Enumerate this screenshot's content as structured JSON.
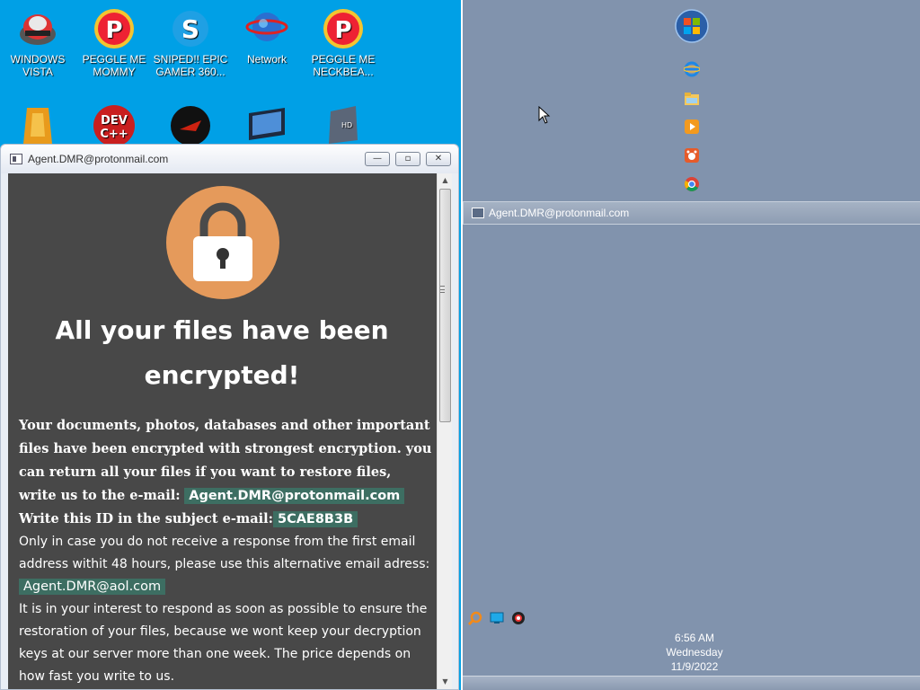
{
  "desktop": {
    "icons": [
      {
        "label": "WINDOWS VISTA"
      },
      {
        "label": "PEGGLE ME MOMMY"
      },
      {
        "label": "SNIPED!! EPIC GAMER 360..."
      },
      {
        "label": "Network"
      },
      {
        "label": "PEGGLE ME NECKBEA..."
      },
      {
        "label": "DEV C++",
        "glyph": "DEV C++"
      }
    ]
  },
  "window": {
    "title": "Agent.DMR@protonmail.com",
    "minimize": "—",
    "maximize": "▫",
    "close": "✕",
    "headline": "All your files have been encrypted!",
    "para1": "Your documents, photos, databases and other important files have been encrypted with strongest encryption. you can return all your files if you want to restore files, write us to the e-mail:",
    "email_primary": "Agent.DMR@protonmail.com",
    "id_prefix": "Write this ID in the subject e-mail:",
    "id_value": "5CAE8B3B",
    "para2": "Only in case you do not receive a response from the first email address withit 48 hours, please use this alternative email adress:",
    "email_alt": "Agent.DMR@aol.com",
    "para3": "It is in your interest to respond as soon as possible to ensure the restoration of your files, because we wont keep your decryption keys at our server more than one week. The price depends on how fast you write to us."
  },
  "taskbar": {
    "window_button": "Agent.DMR@protonmail.com",
    "clock_time": "6:56 AM",
    "clock_day": "Wednesday",
    "clock_date": "11/9/2022"
  },
  "colors": {
    "desktop_bg": "#00a0e6",
    "panel_bg": "#8193ad",
    "window_content_bg": "#484848",
    "lock_circle": "#e59a5b",
    "highlight": "#3d6e62"
  }
}
